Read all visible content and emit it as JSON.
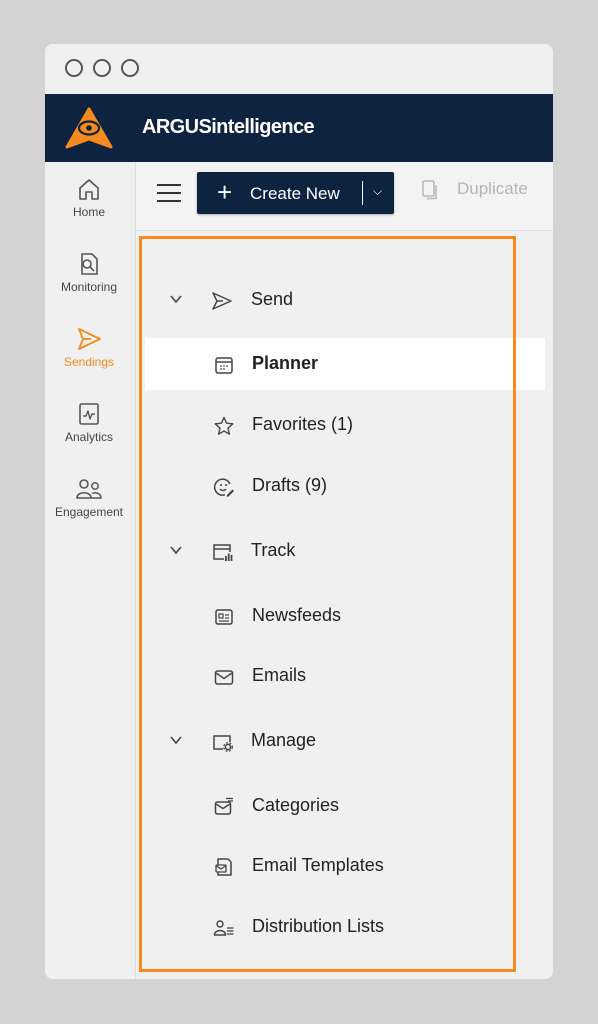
{
  "brand": {
    "name": "ARGUSintelligence",
    "accent": "#f58a1f",
    "navy": "#0e2340"
  },
  "rail": {
    "items": [
      {
        "label": "Home",
        "icon": "home-icon",
        "active": false
      },
      {
        "label": "Monitoring",
        "icon": "monitoring-icon",
        "active": false
      },
      {
        "label": "Sendings",
        "icon": "send-icon",
        "active": true
      },
      {
        "label": "Analytics",
        "icon": "analytics-icon",
        "active": false
      },
      {
        "label": "Engagement",
        "icon": "engagement-icon",
        "active": false
      }
    ]
  },
  "toolbar": {
    "create_label": "Create New",
    "create_plus": "+",
    "create_chevron": "⌵",
    "duplicate_label": "Duplicate"
  },
  "nav": {
    "send": {
      "label": "Send",
      "items": {
        "planner": "Planner",
        "favorites": "Favorites (1)",
        "drafts": "Drafts (9)"
      }
    },
    "track": {
      "label": "Track",
      "items": {
        "newsfeeds": "Newsfeeds",
        "emails": "Emails"
      }
    },
    "manage": {
      "label": "Manage",
      "items": {
        "categories": "Categories",
        "email_templates": "Email Templates",
        "distribution_lists": "Distribution Lists"
      }
    },
    "selected": "Planner"
  }
}
